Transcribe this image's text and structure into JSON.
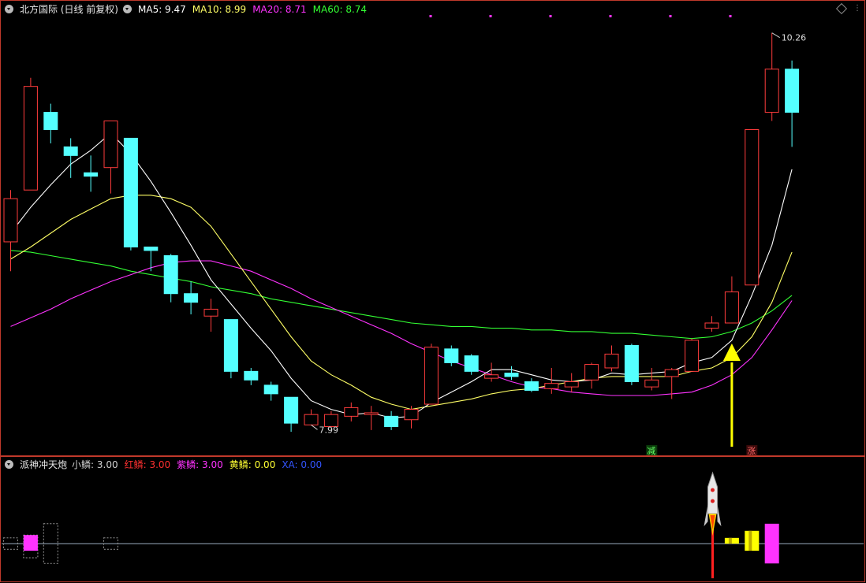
{
  "header": {
    "title": "北方国际 (日线 前复权)",
    "ma5": "MA5: 9.47",
    "ma10": "MA10: 8.99",
    "ma20": "MA20: 8.71",
    "ma60": "MA60: 8.74"
  },
  "indicator": {
    "title": "派神冲天炮",
    "items": [
      {
        "text": "小鳞: 3.00",
        "color": "#d0d0d0"
      },
      {
        "text": "红鳞: 3.00",
        "color": "#ff3030"
      },
      {
        "text": "紫鳞: 3.00",
        "color": "#ff33ff"
      },
      {
        "text": "黄鳞: 0.00",
        "color": "#ffff33"
      },
      {
        "text": "XA: 0.00",
        "color": "#3355ff"
      }
    ]
  },
  "colors": {
    "up": "#ff3c3c",
    "down": "#54ffff",
    "ma5": "#ffffff",
    "ma10": "#ffff66",
    "ma20": "#ff33ff",
    "ma60": "#33ff33",
    "arrow": "#ffff00",
    "frame": "#c0392b"
  },
  "chart_data": {
    "type": "candlestick",
    "ohlc": [
      {
        "o": 9.05,
        "h": 9.35,
        "l": 8.88,
        "c": 9.3
      },
      {
        "o": 9.35,
        "h": 10.0,
        "l": 9.35,
        "c": 9.95
      },
      {
        "o": 9.8,
        "h": 9.85,
        "l": 9.62,
        "c": 9.7
      },
      {
        "o": 9.6,
        "h": 9.65,
        "l": 9.42,
        "c": 9.55
      },
      {
        "o": 9.45,
        "h": 9.55,
        "l": 9.34,
        "c": 9.43
      },
      {
        "o": 9.48,
        "h": 9.75,
        "l": 9.33,
        "c": 9.75
      },
      {
        "o": 9.65,
        "h": 9.65,
        "l": 9.0,
        "c": 9.02
      },
      {
        "o": 9.02,
        "h": 9.02,
        "l": 8.88,
        "c": 9.0
      },
      {
        "o": 8.97,
        "h": 8.98,
        "l": 8.7,
        "c": 8.75
      },
      {
        "o": 8.75,
        "h": 8.82,
        "l": 8.63,
        "c": 8.7
      },
      {
        "o": 8.62,
        "h": 8.72,
        "l": 8.53,
        "c": 8.66
      },
      {
        "o": 8.6,
        "h": 8.6,
        "l": 8.26,
        "c": 8.3
      },
      {
        "o": 8.3,
        "h": 8.32,
        "l": 8.22,
        "c": 8.25
      },
      {
        "o": 8.22,
        "h": 8.24,
        "l": 8.13,
        "c": 8.17
      },
      {
        "o": 8.15,
        "h": 8.15,
        "l": 7.95,
        "c": 8.0
      },
      {
        "o": 7.99,
        "h": 8.08,
        "l": 7.99,
        "c": 8.05
      },
      {
        "o": 7.98,
        "h": 8.07,
        "l": 7.97,
        "c": 8.05
      },
      {
        "o": 8.04,
        "h": 8.12,
        "l": 8.01,
        "c": 8.09
      },
      {
        "o": 8.05,
        "h": 8.1,
        "l": 7.96,
        "c": 8.06
      },
      {
        "o": 8.04,
        "h": 8.07,
        "l": 7.96,
        "c": 7.98
      },
      {
        "o": 8.02,
        "h": 8.1,
        "l": 7.97,
        "c": 8.08
      },
      {
        "o": 8.11,
        "h": 8.46,
        "l": 8.11,
        "c": 8.44
      },
      {
        "o": 8.43,
        "h": 8.45,
        "l": 8.33,
        "c": 8.35
      },
      {
        "o": 8.39,
        "h": 8.4,
        "l": 8.28,
        "c": 8.3
      },
      {
        "o": 8.26,
        "h": 8.35,
        "l": 8.24,
        "c": 8.28
      },
      {
        "o": 8.29,
        "h": 8.33,
        "l": 8.25,
        "c": 8.27
      },
      {
        "o": 8.24,
        "h": 8.26,
        "l": 8.18,
        "c": 8.19
      },
      {
        "o": 8.2,
        "h": 8.32,
        "l": 8.17,
        "c": 8.23
      },
      {
        "o": 8.21,
        "h": 8.29,
        "l": 8.18,
        "c": 8.24
      },
      {
        "o": 8.25,
        "h": 8.35,
        "l": 8.2,
        "c": 8.34
      },
      {
        "o": 8.32,
        "h": 8.45,
        "l": 8.3,
        "c": 8.4
      },
      {
        "o": 8.45,
        "h": 8.46,
        "l": 8.22,
        "c": 8.24
      },
      {
        "o": 8.21,
        "h": 8.32,
        "l": 8.19,
        "c": 8.25
      },
      {
        "o": 8.27,
        "h": 8.32,
        "l": 8.14,
        "c": 8.31
      },
      {
        "o": 8.3,
        "h": 8.49,
        "l": 8.3,
        "c": 8.48
      },
      {
        "o": 8.55,
        "h": 8.62,
        "l": 8.53,
        "c": 8.58
      },
      {
        "o": 8.58,
        "h": 8.85,
        "l": 8.58,
        "c": 8.76
      },
      {
        "o": 8.8,
        "h": 9.7,
        "l": 8.8,
        "c": 9.7
      },
      {
        "o": 9.8,
        "h": 10.26,
        "l": 9.75,
        "c": 10.05
      },
      {
        "o": 10.05,
        "h": 10.1,
        "l": 9.6,
        "c": 9.8
      }
    ],
    "ma5": [
      9.1,
      9.25,
      9.38,
      9.5,
      9.58,
      9.68,
      9.56,
      9.4,
      9.22,
      9.03,
      8.83,
      8.69,
      8.55,
      8.42,
      8.26,
      8.13,
      8.08,
      8.05,
      8.06,
      8.03,
      8.04,
      8.12,
      8.18,
      8.24,
      8.31,
      8.31,
      8.28,
      8.25,
      8.24,
      8.25,
      8.29,
      8.28,
      8.29,
      8.3,
      8.35,
      8.38,
      8.48,
      8.74,
      9.03,
      9.47
    ],
    "ma10": [
      8.95,
      9.02,
      9.1,
      9.18,
      9.24,
      9.3,
      9.32,
      9.32,
      9.3,
      9.25,
      9.14,
      8.98,
      8.82,
      8.66,
      8.5,
      8.36,
      8.28,
      8.22,
      8.15,
      8.11,
      8.08,
      8.1,
      8.12,
      8.14,
      8.17,
      8.19,
      8.2,
      8.22,
      8.24,
      8.26,
      8.27,
      8.27,
      8.27,
      8.27,
      8.3,
      8.32,
      8.38,
      8.5,
      8.7,
      8.99
    ],
    "ma20": [
      8.56,
      8.61,
      8.66,
      8.72,
      8.77,
      8.82,
      8.86,
      8.9,
      8.93,
      8.94,
      8.94,
      8.91,
      8.88,
      8.83,
      8.78,
      8.72,
      8.67,
      8.62,
      8.57,
      8.52,
      8.46,
      8.41,
      8.36,
      8.32,
      8.28,
      8.24,
      8.21,
      8.2,
      8.18,
      8.17,
      8.16,
      8.16,
      8.16,
      8.17,
      8.18,
      8.22,
      8.28,
      8.38,
      8.54,
      8.71
    ],
    "ma60": [
      9.0,
      8.99,
      8.97,
      8.95,
      8.93,
      8.91,
      8.88,
      8.86,
      8.84,
      8.82,
      8.79,
      8.77,
      8.75,
      8.72,
      8.7,
      8.68,
      8.66,
      8.64,
      8.62,
      8.6,
      8.58,
      8.57,
      8.56,
      8.56,
      8.55,
      8.55,
      8.54,
      8.54,
      8.53,
      8.53,
      8.52,
      8.52,
      8.51,
      8.5,
      8.49,
      8.5,
      8.53,
      8.58,
      8.65,
      8.74
    ],
    "price_range": [
      7.85,
      10.35
    ],
    "labels": {
      "high": "10.26",
      "low": "7.99",
      "reduce": "减",
      "rise": "涨"
    },
    "signal_arrow_index": 36,
    "indicator_bars": [
      {
        "index": 36,
        "low": 0.0,
        "high": 0.4,
        "color": "yellow"
      },
      {
        "index": 37,
        "low": -0.5,
        "high": 0.9,
        "color": "yellow"
      },
      {
        "index": 38,
        "low": -1.4,
        "high": 1.4,
        "color": "magenta"
      }
    ],
    "indicator_dotted_boxes": [
      {
        "index": 0,
        "low": -0.4,
        "high": 0.4
      },
      {
        "index": 1,
        "low": -1.0,
        "high": 0.6
      },
      {
        "index": 2,
        "low": -1.4,
        "high": 1.4
      },
      {
        "index": 5,
        "low": -0.4,
        "high": 0.4
      }
    ],
    "indicator_range": [
      -2.5,
      5.0
    ],
    "rocket_index": 35
  }
}
